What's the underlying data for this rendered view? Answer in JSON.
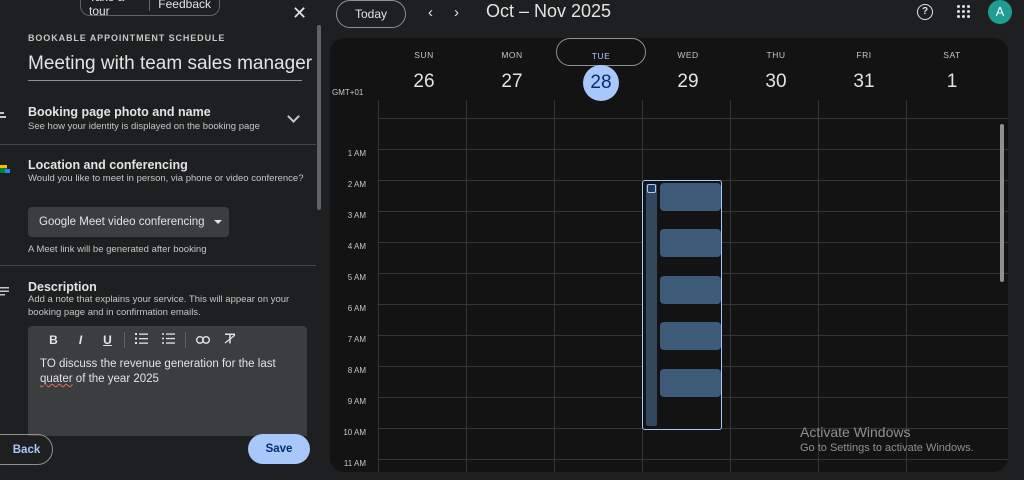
{
  "panel": {
    "tour_label": "Take a tour",
    "feedback_label": "Feedback",
    "close_glyph": "✕",
    "eyebrow": "BOOKABLE APPOINTMENT SCHEDULE",
    "title": "Meeting with team sales manager",
    "booking_page": {
      "heading": "Booking page photo and name",
      "sub": "See how your identity is displayed on the booking page"
    },
    "location": {
      "heading": "Location and conferencing",
      "sub": "Would you like to meet in person, via phone or video conference?",
      "button_label": "Google Meet video conferencing",
      "note": "A Meet link will be generated after booking"
    },
    "description": {
      "heading": "Description",
      "sub": "Add a note that explains your service. This will appear on your booking page and in confirmation emails.",
      "text_line1": "TO discuss the revenue generation for the last",
      "text_misspelled": "quater",
      "text_line2_rest": " of the year 2025",
      "toolbar": [
        "B",
        "I",
        "U",
        "list-numbered",
        "list-bulleted",
        "link",
        "clear-format"
      ]
    },
    "back_label": "Back",
    "save_label": "Save"
  },
  "header": {
    "today_label": "Today",
    "prev_glyph": "‹",
    "next_glyph": "›",
    "date_range": "Oct – Nov 2025",
    "avatar_letter": "A"
  },
  "calendar": {
    "timezone": "GMT+01",
    "days": [
      {
        "dow": "SUN",
        "num": "26"
      },
      {
        "dow": "MON",
        "num": "27"
      },
      {
        "dow": "TUE",
        "num": "28"
      },
      {
        "dow": "WED",
        "num": "29"
      },
      {
        "dow": "THU",
        "num": "30"
      },
      {
        "dow": "FRI",
        "num": "31"
      },
      {
        "dow": "SAT",
        "num": "1"
      }
    ],
    "hours": [
      "1 AM",
      "2 AM",
      "3 AM",
      "4 AM",
      "5 AM",
      "6 AM",
      "7 AM",
      "8 AM",
      "9 AM",
      "10 AM",
      "11 AM"
    ]
  },
  "watermark": {
    "line1": "Activate Windows",
    "line2": "Go to Settings to activate Windows."
  },
  "colors": {
    "accent": "#a8c7fa",
    "slot": "#3d5a78",
    "background": "#1e1f20"
  }
}
